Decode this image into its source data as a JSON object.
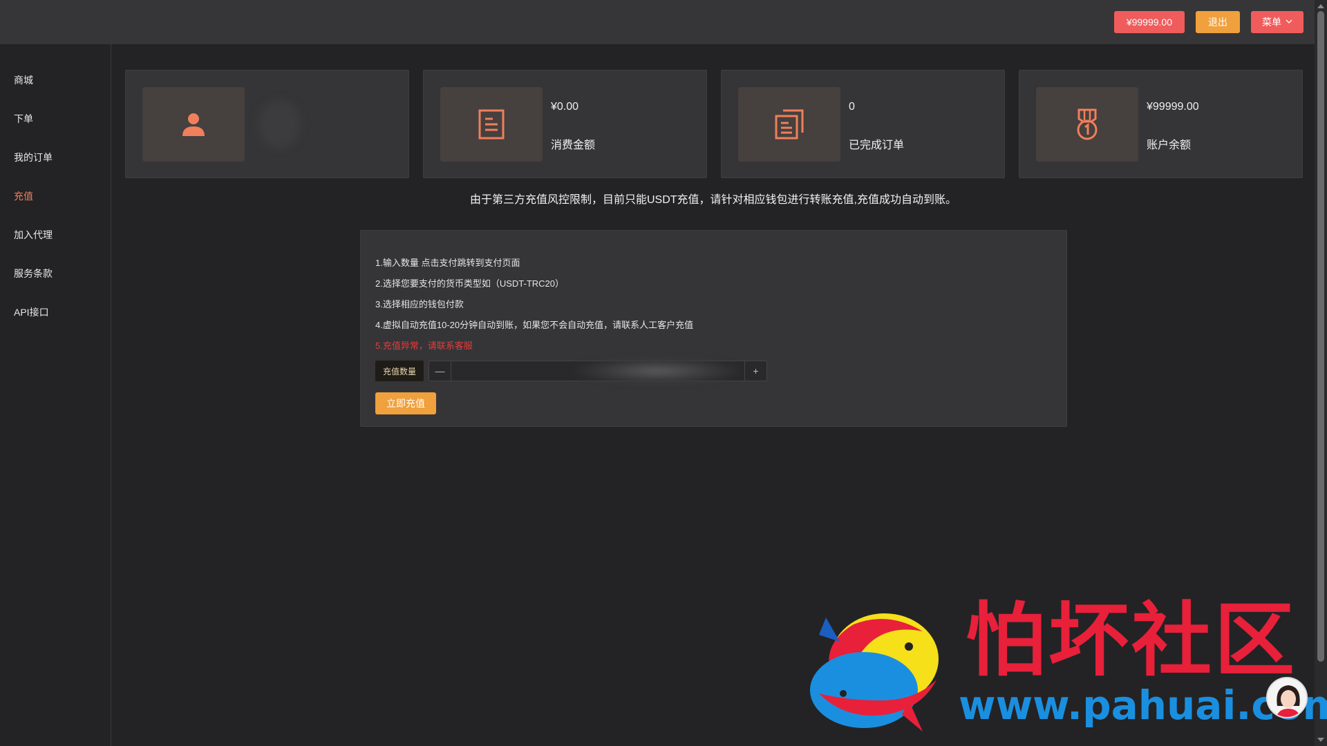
{
  "topbar": {
    "balance_label": "¥99999.00",
    "logout_label": "退出",
    "menu_label": "菜单",
    "colors": {
      "bar": "#363638",
      "balance_btn": "#f05c5c",
      "logout_btn": "#f0a03c",
      "menu_btn": "#f05c5c"
    }
  },
  "sidebar": {
    "items": [
      {
        "label": "商城",
        "active": false
      },
      {
        "label": "下单",
        "active": false
      },
      {
        "label": "我的订单",
        "active": false
      },
      {
        "label": "充值",
        "active": true
      },
      {
        "label": "加入代理",
        "active": false
      },
      {
        "label": "服务条款",
        "active": false
      },
      {
        "label": "API接口",
        "active": false
      }
    ],
    "active_color": "#f07f5c"
  },
  "cards": [
    {
      "icon": "user-icon",
      "value": "",
      "label": ""
    },
    {
      "icon": "document-icon",
      "value": "¥0.00",
      "label": "消费金额"
    },
    {
      "icon": "documents-stack-icon",
      "value": "0",
      "label": "已完成订单"
    },
    {
      "icon": "medal-icon",
      "value": "¥99999.00",
      "label": "账户余额"
    }
  ],
  "notice": "由于第三方充值风控限制，目前只能USDT充值，请针对相应钱包进行转账充值,充值成功自动到账。",
  "recharge": {
    "steps": [
      "1.输入数量 点击支付跳转到支付页面",
      "2.选择您要支付的货币类型如（USDT-TRC20）",
      "3.选择相应的钱包付款",
      "4.虚拟自动充值10-20分钟自动到账，如果您不会自动充值，请联系人工客户充值"
    ],
    "warning": "5.充值异常，请联系客服",
    "warning_color": "#e83a3a",
    "quantity_label": "充值数量",
    "quantity_value": "",
    "minus_glyph": "—",
    "plus_glyph": "+",
    "submit_label": "立即充值"
  },
  "watermark": {
    "title": "怕坏社区",
    "url": "www.pahuai.com",
    "colors": {
      "title": "#e8203a",
      "url": "#1a8fe0"
    }
  }
}
